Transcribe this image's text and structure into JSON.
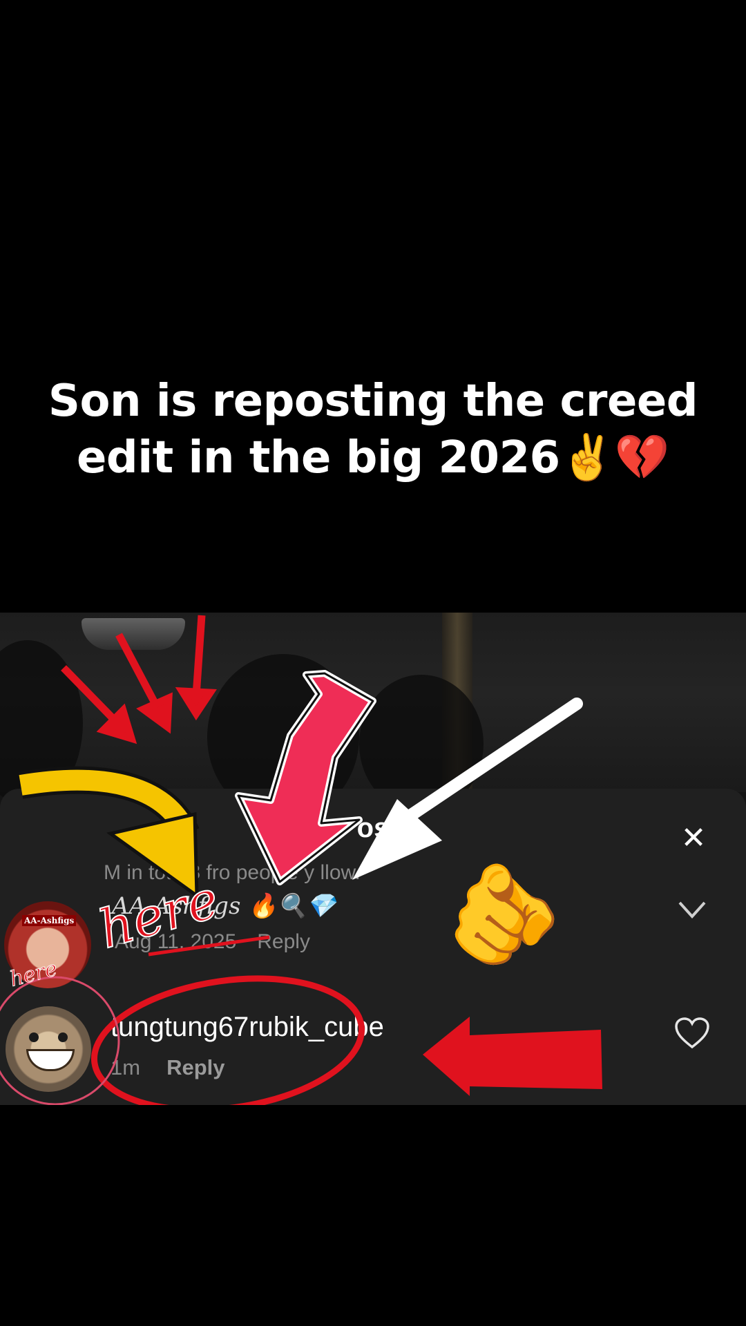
{
  "caption": {
    "line1": "Son is reposting the creed",
    "line2": "edit in the big 2026✌️💔"
  },
  "sheet": {
    "title": "os",
    "subtitle": "M in tot   28 fro  people y     llow.",
    "close_icon": "close-icon"
  },
  "comments": [
    {
      "avatar_tag": "AA-Ashfigs",
      "username": "AA-Ashfigs 🔥🔍💎",
      "date": "Aug 11, 2025",
      "reply_label": "Reply",
      "action_icon": "chevron-down-icon"
    },
    {
      "username": "tungtung67rubik_cube",
      "time": "1m",
      "reply_label": "Reply",
      "action_icon": "heart-icon"
    }
  ],
  "annotations": {
    "here_large": "here",
    "here_small": "here",
    "pointing_emoji": "🫵",
    "colors": {
      "red_arrow": "#e0121e",
      "pink_arrow": "#ef2d56",
      "yellow_arrow": "#f5c400",
      "white_arrow": "#ffffff"
    }
  }
}
